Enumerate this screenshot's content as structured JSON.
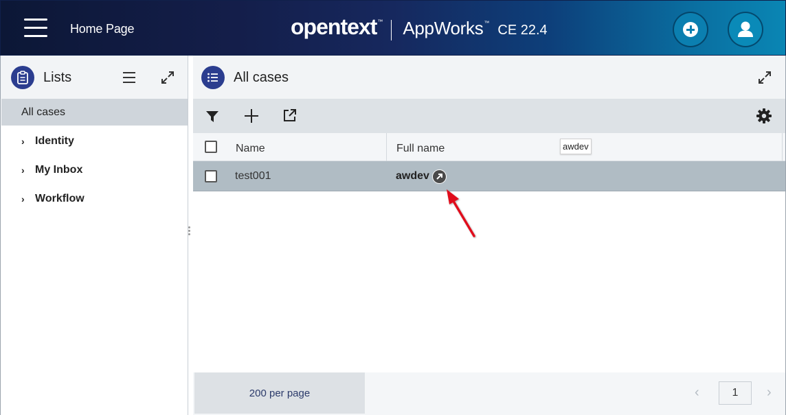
{
  "header": {
    "home_title": "Home Page",
    "brand_name": "opentext",
    "brand_tm": "™",
    "product_name": "AppWorks",
    "product_tm": "™",
    "version": "CE 22.4"
  },
  "left_panel": {
    "title": "Lists",
    "items": [
      {
        "label": "All cases",
        "active": true
      },
      {
        "label": "Identity",
        "expandable": true
      },
      {
        "label": "My Inbox",
        "expandable": true
      },
      {
        "label": "Workflow",
        "expandable": true
      }
    ]
  },
  "main_panel": {
    "title": "All cases",
    "toolbar": {
      "icons": [
        "filter-icon",
        "add-icon",
        "export-icon",
        "settings-icon"
      ]
    },
    "columns": [
      "Name",
      "Full name"
    ],
    "tooltip": "awdev",
    "rows": [
      {
        "name": "test001",
        "full_name": "awdev",
        "selected": true
      }
    ],
    "footer": {
      "per_page": "200 per page",
      "page": "1"
    }
  },
  "colors": {
    "header_start": "#0c1736",
    "header_end": "#0a86b4",
    "accent": "#2b3d8f",
    "selected_row": "#b0bcc4",
    "pointer_arrow": "#e0101e"
  }
}
